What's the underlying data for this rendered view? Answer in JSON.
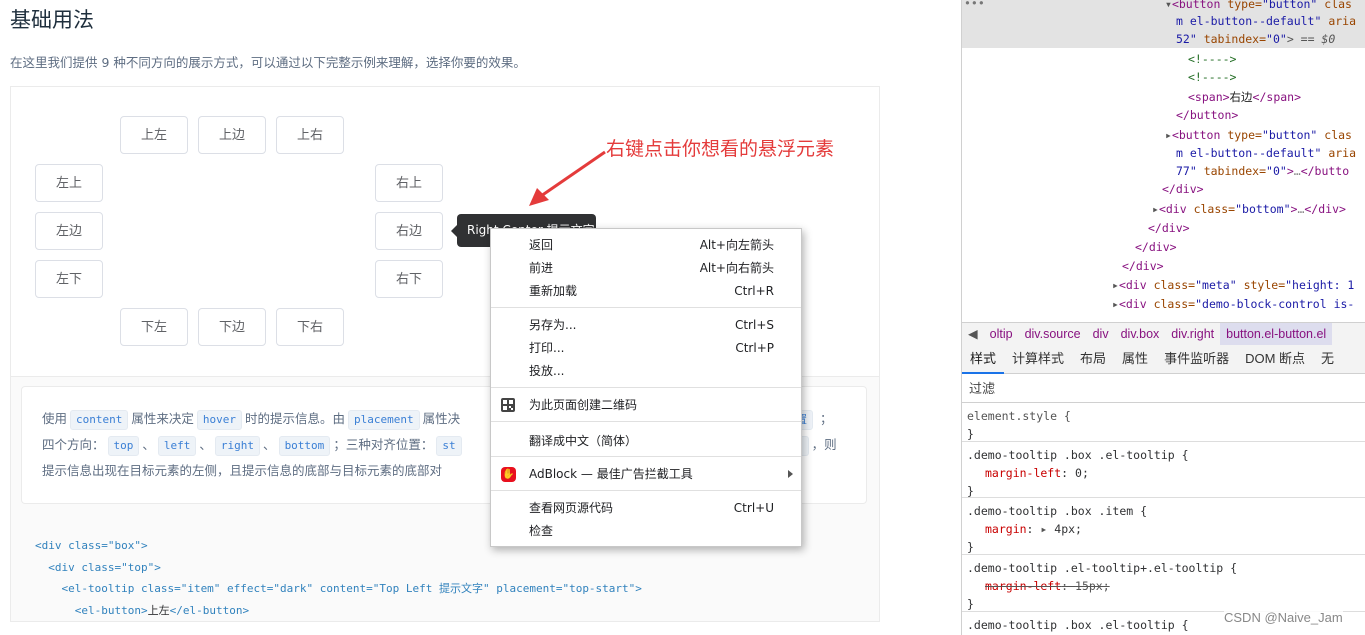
{
  "page": {
    "title": "基础用法",
    "description": "在这里我们提供 9 种不同方向的展示方式，可以通过以下完整示例来理解，选择你要的效果。"
  },
  "demo": {
    "buttons": {
      "top_left": "上左",
      "top": "上边",
      "top_right": "上右",
      "left_top": "左上",
      "left": "左边",
      "left_bottom": "左下",
      "right_top": "右上",
      "right": "右边",
      "right_bottom": "右下",
      "bottom_left": "下左",
      "bottom": "下边",
      "bottom_right": "下右"
    },
    "tooltip": "Right Center 提示文字",
    "annotation": "右键点击你想看的悬浮元素"
  },
  "description_box": {
    "line1_a": "使用",
    "chip_content": "content",
    "line1_b": "属性来决定",
    "chip_hover": "hover",
    "line1_c": "时的提示信息。由",
    "chip_placement": "placement",
    "line1_d": "属性决",
    "line1_end_a": "置",
    "line1_end_b": "；",
    "line2_a": "四个方向：",
    "chip_top": "top",
    "sep": "、",
    "chip_left": "left",
    "chip_right": "right",
    "chip_bottom": "bottom",
    "line2_b": "；三种对齐位置：",
    "chip_st": "st",
    "chip_end": "\"",
    "line2_c": "，则",
    "line3": "提示信息出现在目标元素的左侧，且提示信息的底部与目标元素的底部对"
  },
  "code": {
    "l1a": "<div class=\"box\">",
    "l2a": "  <div class=\"top\">",
    "l3a": "    <el-tooltip class=\"item\" effect=\"dark\" content=\"Top Left 提示文字\" placement=\"top-start\">",
    "l4a": "      <el-button>",
    "l4b": "上左",
    "l4c": "</el-button>"
  },
  "context_menu": {
    "items": [
      {
        "label": "返回",
        "shortcut": "Alt+向左箭头"
      },
      {
        "label": "前进",
        "shortcut": "Alt+向右箭头"
      },
      {
        "label": "重新加载",
        "shortcut": "Ctrl+R"
      },
      {
        "label": "另存为...",
        "shortcut": "Ctrl+S"
      },
      {
        "label": "打印...",
        "shortcut": "Ctrl+P"
      },
      {
        "label": "投放...",
        "shortcut": ""
      },
      {
        "label": "为此页面创建二维码",
        "shortcut": ""
      },
      {
        "label": "翻译成中文（简体）",
        "shortcut": ""
      },
      {
        "label": "AdBlock — 最佳广告拦截工具",
        "shortcut": ""
      },
      {
        "label": "查看网页源代码",
        "shortcut": "Ctrl+U"
      },
      {
        "label": "检查",
        "shortcut": ""
      }
    ]
  },
  "devtools": {
    "dom": {
      "l0_dots": "•••",
      "l0_a": "<button",
      "l0_b": " type=",
      "l0_c": "\"button\"",
      "l0_d": " clas",
      "l1_a": "m el-button--default\"",
      "l1_b": " aria",
      "l2_a": "52\"",
      "l2_b": " tabindex=",
      "l2_c": "\"0\"",
      "l2_d": "> == $0",
      "l3": "<!---->",
      "l4": "<!---->",
      "l5_a": "<span>",
      "l5_b": "右边",
      "l5_c": "</span>",
      "l6": "</button>",
      "l7_a": "<button",
      "l7_b": " type=",
      "l7_c": "\"button\"",
      "l7_d": " clas",
      "l8_a": "m el-button--default\"",
      "l8_b": " aria",
      "l9_a": "77\"",
      "l9_b": " tabindex=",
      "l9_c": "\"0\"",
      "l9_d": ">",
      "l9_e": "</butto",
      "l10": "</div>",
      "l11_a": "<div",
      "l11_b": " class=",
      "l11_c": "\"bottom\"",
      "l11_d": ">",
      "l11_e": "</div>",
      "l12": "</div>",
      "l13": "</div>",
      "l14": "</div>",
      "l15_a": "<div",
      "l15_b": " class=",
      "l15_c": "\"meta\"",
      "l15_d": " style=",
      "l15_e": "\"height: 1",
      "l16_a": "<div",
      "l16_b": " class=",
      "l16_c": "\"demo-block-control is-"
    },
    "breadcrumbs": [
      "oltip",
      "div.source",
      "div",
      "div.box",
      "div.right",
      "button.el-button.el"
    ],
    "tabs": [
      "样式",
      "计算样式",
      "布局",
      "属性",
      "事件监听器",
      "DOM 断点",
      "无"
    ],
    "filter_label": "过滤",
    "rules": [
      {
        "selector": "element.style {",
        "prop": "",
        "value": ""
      },
      {
        "selector": ".demo-tooltip .box .el-tooltip {",
        "prop": "margin-left",
        "value": "0;"
      },
      {
        "selector": ".demo-tooltip .box .item {",
        "prop": "margin",
        "value": "4px;"
      },
      {
        "selector": ".demo-tooltip .el-tooltip+.el-tooltip {",
        "prop": "margin-left",
        "value": "15px;"
      }
    ],
    "closing_brace": "}",
    "next_rule": ".demo-tooltip .box .el-tooltip {"
  },
  "watermark": "CSDN @Naive_Jam"
}
